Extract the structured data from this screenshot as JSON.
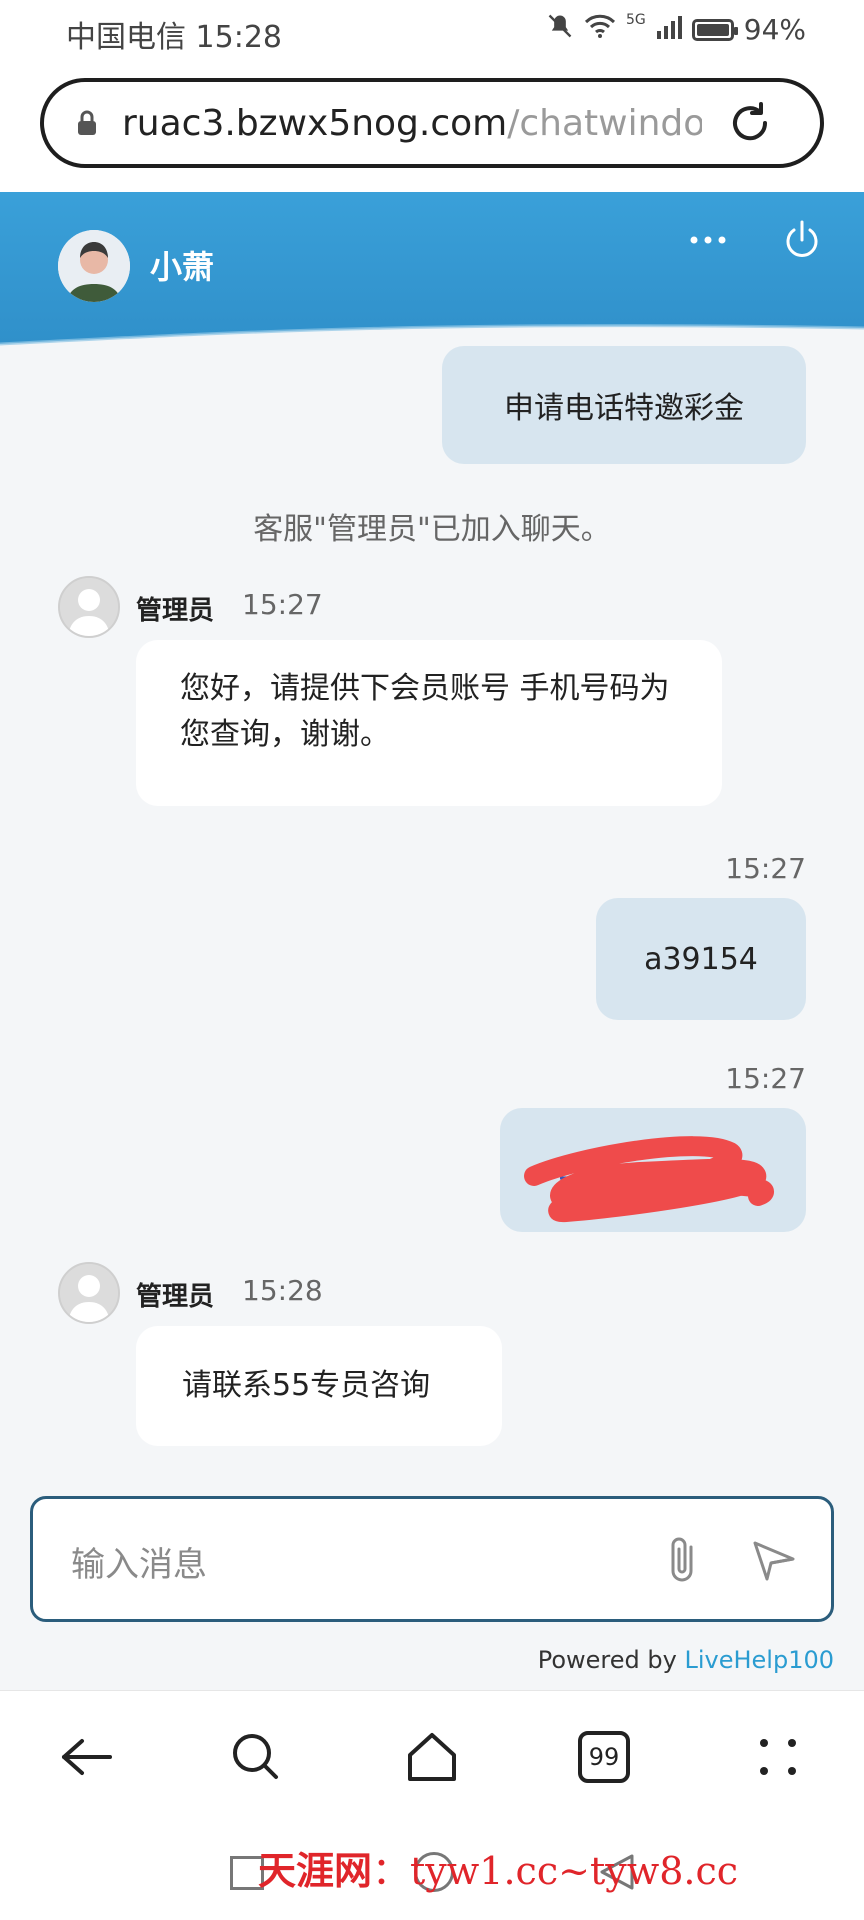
{
  "status_bar": {
    "carrier_time": "中国电信 15:28",
    "network": "5G",
    "battery": "94%",
    "battery_level": 0.94
  },
  "browser": {
    "url_host": "ruac3.bzwx5nog.com",
    "url_path": "/chatwindow",
    "nav_icons": [
      "back-icon",
      "search-icon",
      "home-icon",
      "tabs-icon",
      "menu-icon"
    ],
    "tab_count": "99"
  },
  "chat": {
    "agent_name": "小萧",
    "messages": [
      {
        "side": "right",
        "text": "申请电话特邀彩金"
      },
      {
        "type": "system",
        "text": "客服\"管理员\"已加入聊天。"
      },
      {
        "side": "left",
        "sender": "管理员",
        "time": "15:27",
        "text": "您好，请提供下会员账号 手机号码为您查询，谢谢。"
      },
      {
        "side": "right",
        "time": "15:27",
        "text": "a39154"
      },
      {
        "side": "right",
        "time": "15:27",
        "text": ""
      },
      {
        "side": "left",
        "sender": "管理员",
        "time": "15:28",
        "text": "请联系55专员咨询"
      }
    ],
    "input_placeholder": "输入消息",
    "powered_prefix": "Powered by ",
    "powered_brand": "LiveHelp100"
  },
  "watermark": {
    "cn": "天涯网",
    "sep": "：",
    "url": "tyw1.cc~tyw8.cc"
  },
  "colors": {
    "header": "#2f8fc9",
    "bubble_right": "#d7e5ef",
    "bubble_left": "#ffffff",
    "brand_link": "#2a9cd1",
    "scribble": "#ef4b4b"
  }
}
